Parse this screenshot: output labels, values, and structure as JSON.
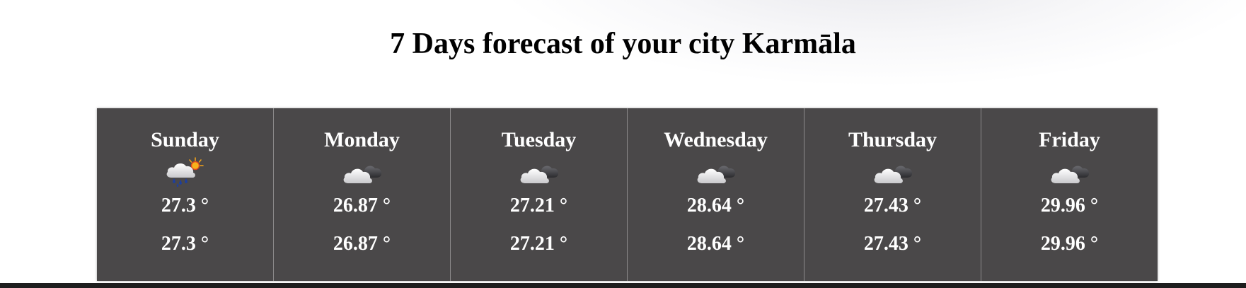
{
  "page": {
    "title": "7 Days forecast of your city Karmāla"
  },
  "forecast": {
    "days": [
      {
        "name": "Sunday",
        "icon": "rain-sun-cloud-icon",
        "temp_max": "27.3 °",
        "temp_min": "27.3 °"
      },
      {
        "name": "Monday",
        "icon": "partly-cloudy-icon",
        "temp_max": "26.87 °",
        "temp_min": "26.87 °"
      },
      {
        "name": "Tuesday",
        "icon": "partly-cloudy-icon",
        "temp_max": "27.21 °",
        "temp_min": "27.21 °"
      },
      {
        "name": "Wednesday",
        "icon": "partly-cloudy-icon",
        "temp_max": "28.64 °",
        "temp_min": "28.64 °"
      },
      {
        "name": "Thursday",
        "icon": "partly-cloudy-icon",
        "temp_max": "27.43 °",
        "temp_min": "27.43 °"
      },
      {
        "name": "Friday",
        "icon": "partly-cloudy-icon",
        "temp_max": "29.96 °",
        "temp_min": "29.96 °"
      }
    ]
  },
  "colors": {
    "card_background": "#4a4849",
    "divider": "#8c8a8b",
    "text_on_card": "#ffffff",
    "title_text": "#000000"
  }
}
